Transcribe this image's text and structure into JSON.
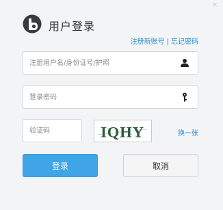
{
  "window": {
    "close_glyph": "×"
  },
  "header": {
    "title": "用户登录",
    "logo_icon": "baidu-bear-paw-logo"
  },
  "links": {
    "register": "注册新账号",
    "separator": "|",
    "forgot_password": "忘记密码"
  },
  "form": {
    "username_placeholder": "注册用户名/身份证号/护照",
    "username_value": "",
    "username_icon": "user-icon",
    "password_placeholder": "登录密码",
    "password_value": "",
    "password_icon": "key-icon",
    "captcha_placeholder": "验证码",
    "captcha_value": "",
    "captcha_text": "IQHY",
    "refresh_label": "换一张"
  },
  "buttons": {
    "login": "登录",
    "cancel": "取消"
  },
  "colors": {
    "background": "#f2f4f6",
    "link": "#2b8fd6",
    "primary": "#3fa4e8",
    "secondary": "#f5f5f5"
  }
}
